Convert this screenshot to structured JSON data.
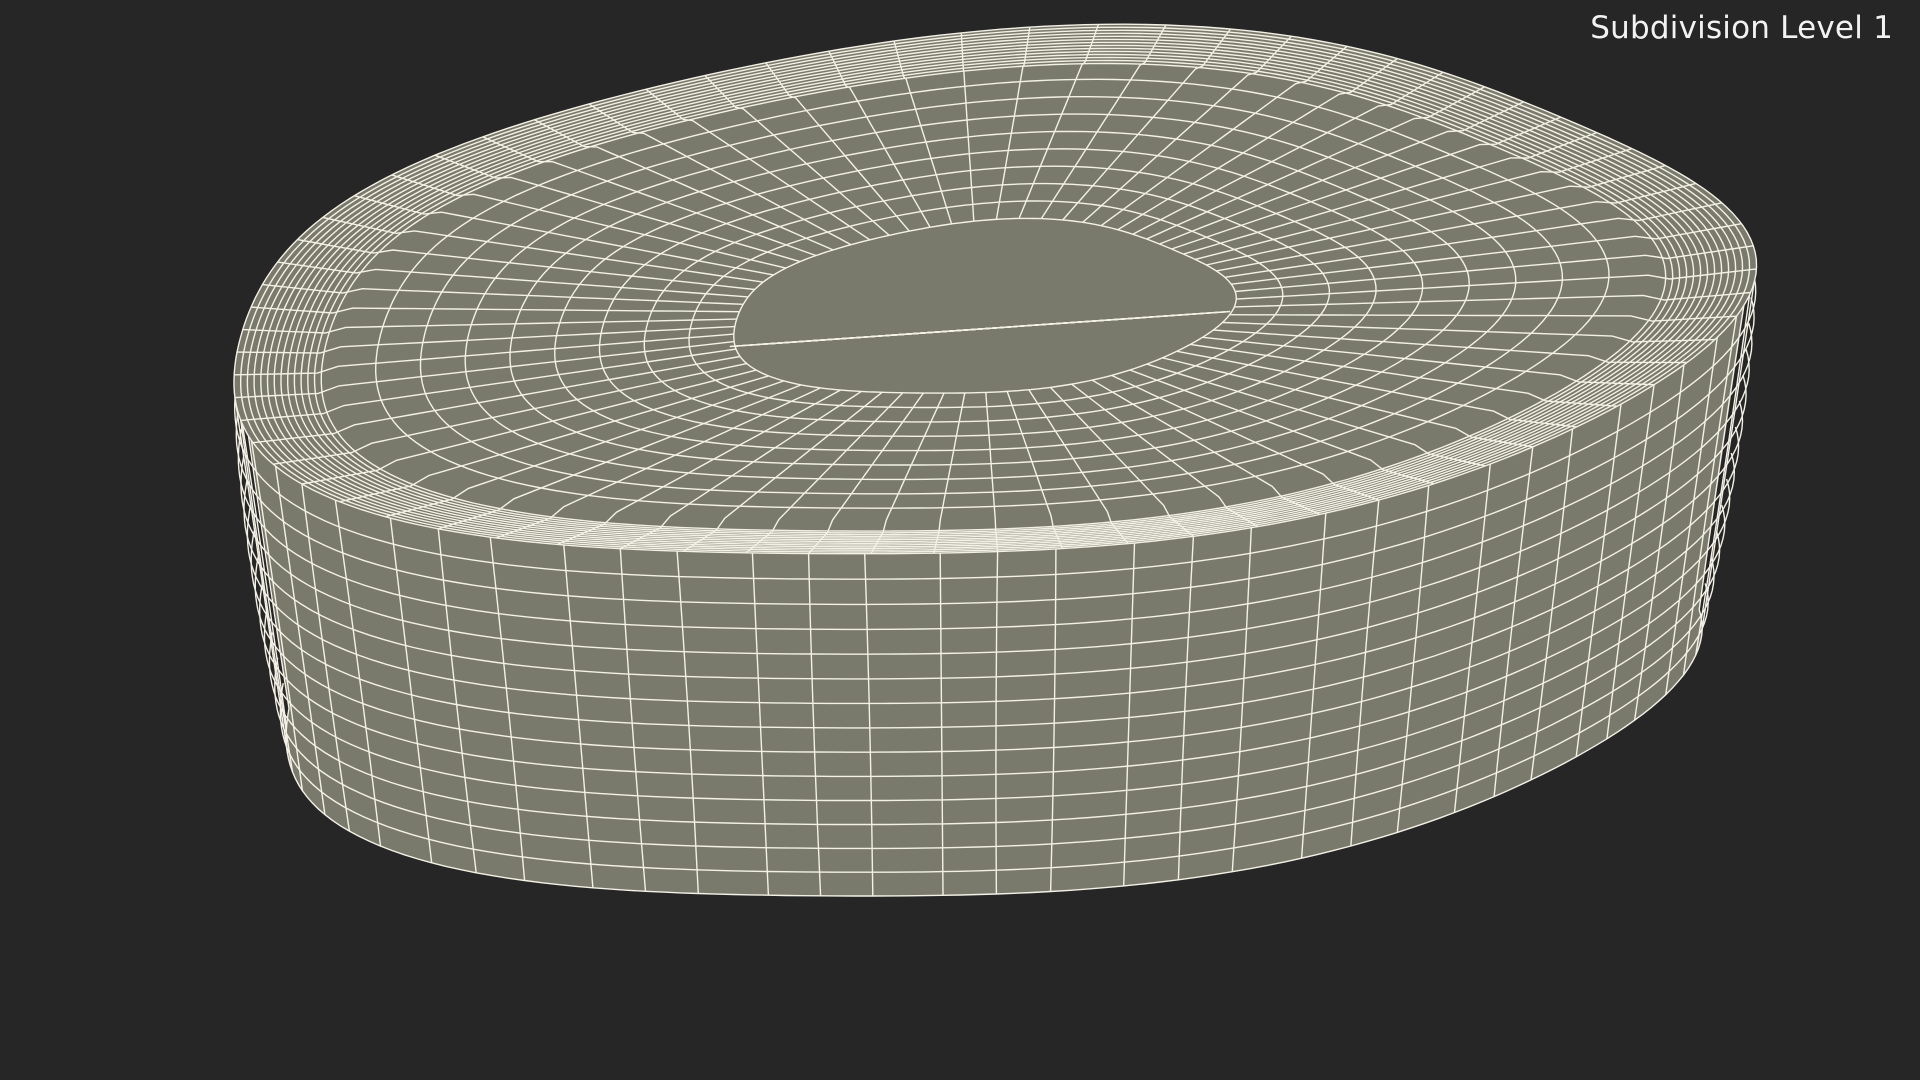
{
  "viewport": {
    "label": "Subdivision Level 1",
    "background_color": "#262626",
    "mesh_fill_color": "#7a7a6c",
    "wire_color": "#f3f1e6"
  }
}
